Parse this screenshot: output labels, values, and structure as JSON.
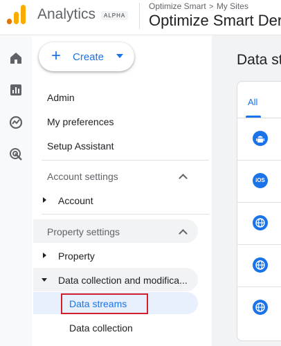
{
  "header": {
    "app_title": "Analytics",
    "badge": "ALPHA",
    "breadcrumb": {
      "account": "Optimize Smart",
      "separator": ">",
      "section": "My Sites"
    },
    "property_name": "Optimize Smart Der"
  },
  "rail": {
    "icons": [
      "home-icon",
      "reports-icon",
      "explore-icon",
      "advertising-icon"
    ]
  },
  "nav": {
    "create_label": "Create",
    "items": [
      "Admin",
      "My preferences",
      "Setup Assistant"
    ],
    "account_settings": {
      "label": "Account settings",
      "child": "Account"
    },
    "property_settings": {
      "label": "Property settings",
      "child_property": "Property",
      "child_data_collection": "Data collection and modifica...",
      "sub_data_streams": "Data streams",
      "sub_data_collection": "Data collection"
    }
  },
  "main": {
    "title": "Data st",
    "tab_all": "All",
    "ios_label": "iOS",
    "streams": [
      "android-icon",
      "ios-icon",
      "web-icon",
      "web-icon",
      "web-icon"
    ]
  },
  "colors": {
    "accent": "#1a73e8",
    "highlight": "#d21f2b",
    "logo_orange": "#f9ab00",
    "logo_dark": "#e37400"
  }
}
